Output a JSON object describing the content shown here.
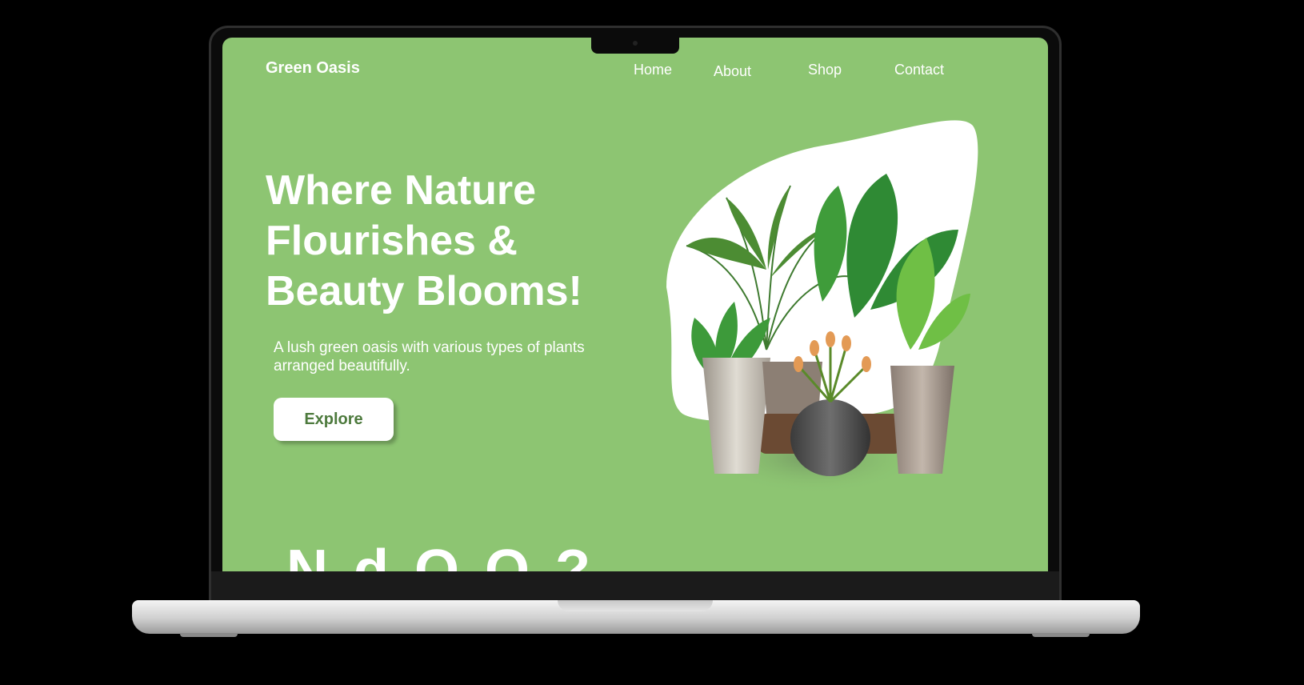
{
  "site": {
    "brand": "Green Oasis",
    "nav": [
      {
        "label": "Home"
      },
      {
        "label": "About"
      },
      {
        "label": "Shop"
      },
      {
        "label": "Contact"
      }
    ]
  },
  "hero": {
    "title_lines": [
      "Where Nature",
      "Flourishes &",
      "Beauty Blooms!"
    ],
    "description": "A lush green oasis with various types of plants arranged beautifully.",
    "cta_label": "Explore",
    "image_icon": "potted-plants-illustration"
  },
  "next_section": {
    "partial_heading": "N  d  O  O  ?"
  },
  "colors": {
    "background": "#8dc572",
    "accent_text": "#4d7a3d",
    "white": "#ffffff",
    "device_frame": "#0b0b0b"
  }
}
